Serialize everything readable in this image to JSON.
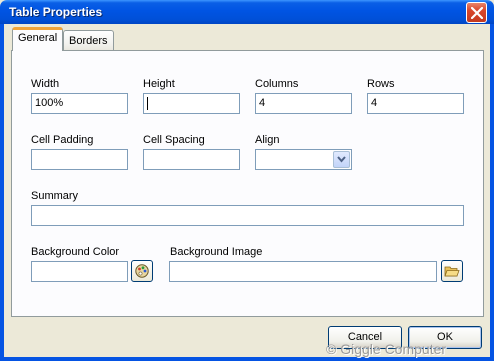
{
  "window": {
    "title": "Table Properties"
  },
  "tabs": [
    {
      "label": "General",
      "active": true
    },
    {
      "label": "Borders",
      "active": false
    }
  ],
  "fields": {
    "width": {
      "label": "Width",
      "value": "100%"
    },
    "height": {
      "label": "Height",
      "value": ""
    },
    "columns": {
      "label": "Columns",
      "value": "4"
    },
    "rows": {
      "label": "Rows",
      "value": "4"
    },
    "cell_padding": {
      "label": "Cell Padding",
      "value": ""
    },
    "cell_spacing": {
      "label": "Cell Spacing",
      "value": ""
    },
    "align": {
      "label": "Align",
      "value": ""
    },
    "summary": {
      "label": "Summary",
      "value": ""
    },
    "background_color": {
      "label": "Background Color",
      "value": ""
    },
    "background_image": {
      "label": "Background Image",
      "value": ""
    }
  },
  "buttons": {
    "cancel": "Cancel",
    "ok": "OK"
  },
  "watermark": "© Giggle Computer",
  "colors": {
    "titlebar": "#0054e3",
    "active_tab_accent": "#f1a439",
    "panel": "#fcfcfe",
    "dialog": "#ece9d8"
  },
  "icons": {
    "close": "close-icon",
    "dropdown": "chevron-down-icon",
    "color_picker": "color-palette-icon",
    "browse": "folder-open-icon"
  }
}
